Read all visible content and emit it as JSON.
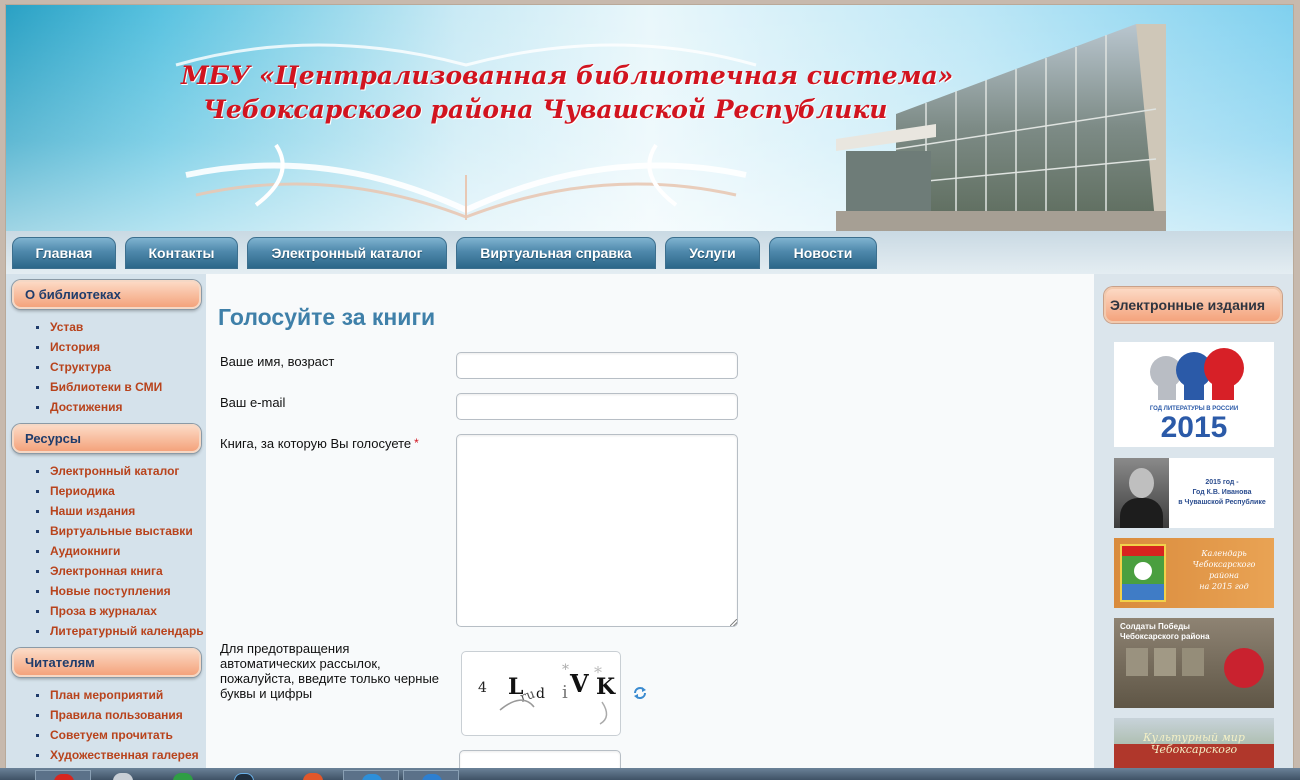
{
  "header": {
    "title_line1": "МБУ «Централизованная библиотечная система»",
    "title_line2": "Чебоксарского района Чувашской Республики"
  },
  "nav": {
    "items": [
      {
        "label": "Главная"
      },
      {
        "label": "Контакты"
      },
      {
        "label": "Электронный каталог"
      },
      {
        "label": "Виртуальная справка"
      },
      {
        "label": "Услуги"
      },
      {
        "label": "Новости"
      }
    ]
  },
  "sidebar": {
    "sections": [
      {
        "title": "О библиотеках",
        "items": [
          "Устав",
          "История",
          "Структура",
          "Библиотеки в СМИ",
          "Достижения"
        ]
      },
      {
        "title": "Ресурсы",
        "items": [
          "Электронный каталог",
          "Периодика",
          "Наши издания",
          "Виртуальные выставки",
          "Аудиокниги",
          "Электронная книга",
          "Новые поступления",
          "Проза в журналах",
          "Литературный календарь"
        ]
      },
      {
        "title": "Читателям",
        "items": [
          "План мероприятий",
          "Правила пользования",
          "Советуем прочитать",
          "Художественная галерея"
        ]
      }
    ]
  },
  "main": {
    "page_title": "Голосуйте за книги",
    "form": {
      "name_label": "Ваше имя, возраст",
      "name_value": "",
      "email_label": "Ваш e-mail",
      "email_value": "",
      "book_label": "Книга, за которую Вы голосуете",
      "book_required": "*",
      "book_value": "",
      "captcha_label": "Для предотвращения автоматических рассылок, пожалуйста, введите только черные буквы и цифры",
      "captcha_value": ""
    }
  },
  "right_sidebar": {
    "title": "Электронные издания",
    "banners": [
      {
        "caption": "ГОД ЛИТЕРАТУРЫ В РОССИИ",
        "year": "2015"
      },
      {
        "caption_line1": "2015 год -",
        "caption_line2": "Год К.В. Иванова",
        "caption_line3": "в Чувашской Республике"
      },
      {
        "caption_line1": "Календарь",
        "caption_line2": "Чебоксарского",
        "caption_line3": "района",
        "caption_line4": "на 2015 год"
      },
      {
        "caption_line1": "Солдаты Победы",
        "caption_line2": "Чебоксарского района"
      },
      {
        "caption_line1": "Культурный мир",
        "caption_line2": "Чебоксарского"
      }
    ]
  },
  "colors": {
    "accent_title": "#3f80a9",
    "link": "#b8431c",
    "header_red": "#d1141f",
    "nav_blue": "#2c6789"
  }
}
